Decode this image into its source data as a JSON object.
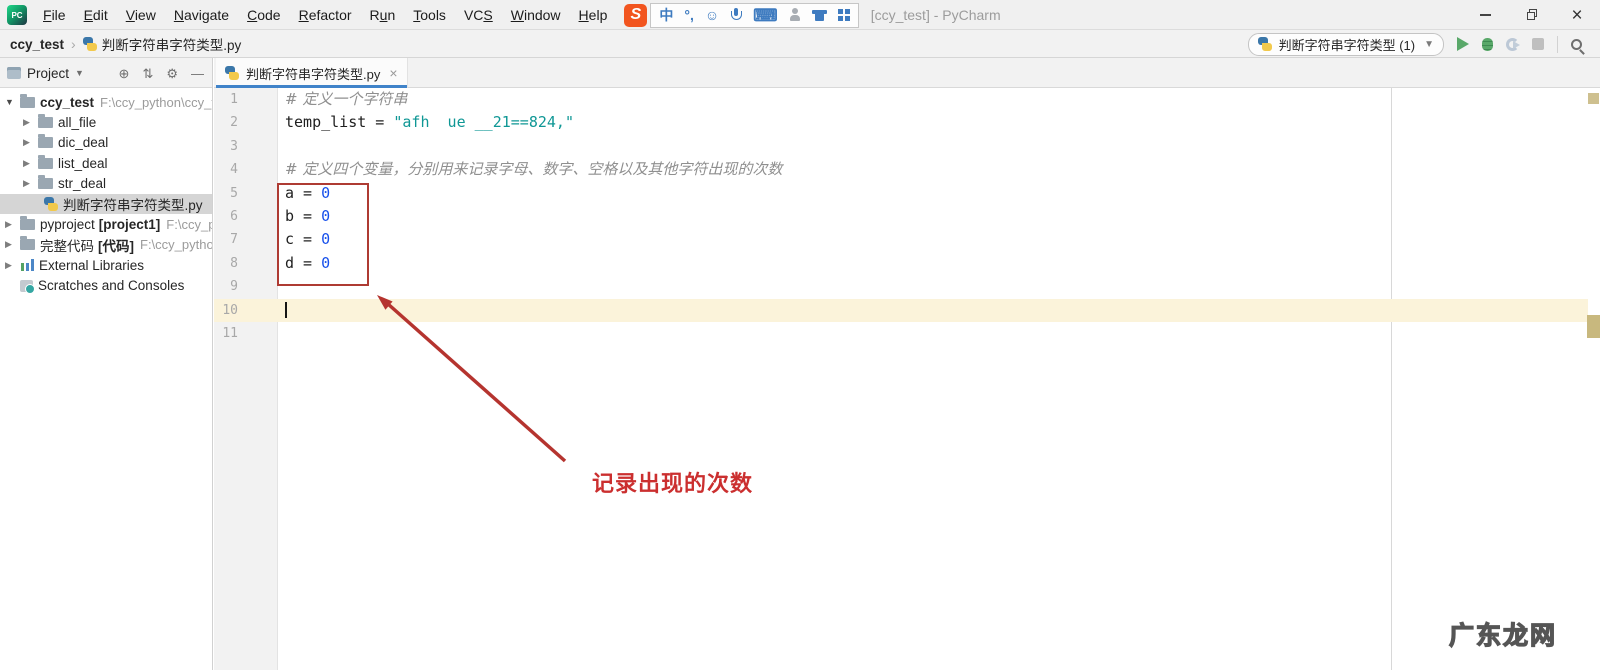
{
  "title_bar": {
    "logo_text": "PC",
    "menus": [
      {
        "pre": "",
        "u": "F",
        "post": "ile"
      },
      {
        "pre": "",
        "u": "E",
        "post": "dit"
      },
      {
        "pre": "",
        "u": "V",
        "post": "iew"
      },
      {
        "pre": "",
        "u": "N",
        "post": "avigate"
      },
      {
        "pre": "",
        "u": "C",
        "post": "ode"
      },
      {
        "pre": "",
        "u": "R",
        "post": "efactor"
      },
      {
        "pre": "R",
        "u": "u",
        "post": "n"
      },
      {
        "pre": "",
        "u": "T",
        "post": "ools"
      },
      {
        "pre": "VC",
        "u": "S",
        "post": ""
      },
      {
        "pre": "",
        "u": "W",
        "post": "indow"
      },
      {
        "pre": "",
        "u": "H",
        "post": "elp"
      }
    ],
    "ime": {
      "logo": "S",
      "chinese_mode_glyph": "中",
      "punctuation_glyph": "°,",
      "emoji_glyph": "☺",
      "keyboard_glyph": "⌨",
      "icons": [
        "sogou-logo",
        "chinese-mode",
        "punctuation",
        "emoji",
        "microphone",
        "keyboard",
        "user-mode",
        "skin",
        "apps-grid"
      ]
    },
    "window_title": "[ccy_test] - PyCharm"
  },
  "nav_bar": {
    "breadcrumb_project": "ccy_test",
    "breadcrumb_file": "判断字符串字符类型.py",
    "run_config_label": "判断字符串字符类型 (1)"
  },
  "project_panel": {
    "header_title": "Project",
    "tree": [
      {
        "label": "ccy_test",
        "bracket": "",
        "path": "F:\\ccy_python\\ccy_t"
      },
      {
        "label": "all_file",
        "bracket": "",
        "path": ""
      },
      {
        "label": "dic_deal",
        "bracket": "",
        "path": ""
      },
      {
        "label": "list_deal",
        "bracket": "",
        "path": ""
      },
      {
        "label": "str_deal",
        "bracket": "",
        "path": ""
      },
      {
        "label": "判断字符串字符类型.py",
        "bracket": "",
        "path": ""
      },
      {
        "label": "pyproject",
        "bracket": "[project1]",
        "path": "F:\\ccy_p"
      },
      {
        "label": "完整代码",
        "bracket": "[代码]",
        "path": "F:\\ccy_python"
      },
      {
        "label": "External Libraries",
        "bracket": "",
        "path": ""
      },
      {
        "label": "Scratches and Consoles",
        "bracket": "",
        "path": ""
      }
    ]
  },
  "editor": {
    "tab_title": "判断字符串字符类型.py",
    "lines": [
      {
        "num": "1",
        "t0": "# 定义一个字符串",
        "t1": ""
      },
      {
        "num": "2",
        "t0": "temp_list = ",
        "t1": "\"afh  ue __21==824,\""
      },
      {
        "num": "3",
        "t0": "",
        "t1": ""
      },
      {
        "num": "4",
        "t0": "# 定义四个变量，分别用来记录字母、数字、空格以及其他字符出现的次数",
        "t1": ""
      },
      {
        "num": "5",
        "t0": "a = ",
        "t1": "0"
      },
      {
        "num": "6",
        "t0": "b = ",
        "t1": "0"
      },
      {
        "num": "7",
        "t0": "c = ",
        "t1": "0"
      },
      {
        "num": "8",
        "t0": "d = ",
        "t1": "0"
      },
      {
        "num": "9",
        "t0": "",
        "t1": ""
      },
      {
        "num": "10",
        "t0": "",
        "t1": ""
      },
      {
        "num": "11",
        "t0": "",
        "t1": ""
      }
    ],
    "annotation_label": "记录出现的次数"
  },
  "watermark": "广东龙网",
  "colors": {
    "accent_tab_underline": "#4083C9",
    "string": "#0F9795",
    "number": "#1750EB",
    "comment": "#8F8F8F",
    "annotation_red": "#B5342F",
    "run_green": "#59A869",
    "caret_line": "#FBF3DA",
    "stripe_mark": "#CBBC86"
  }
}
